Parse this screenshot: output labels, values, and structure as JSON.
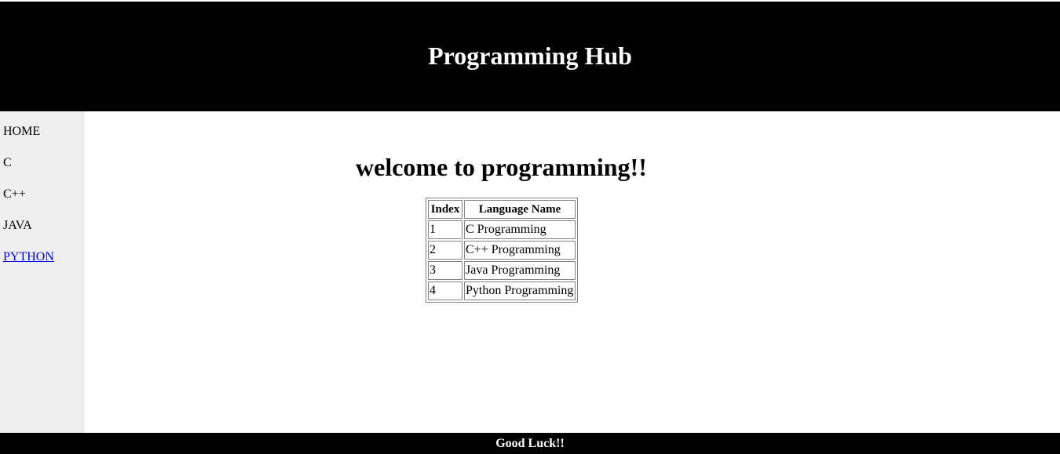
{
  "header": {
    "title": "Programming Hub"
  },
  "sidebar": {
    "items": [
      {
        "label": "HOME"
      },
      {
        "label": "C"
      },
      {
        "label": "C++"
      },
      {
        "label": "JAVA"
      },
      {
        "label": "PYTHON"
      }
    ],
    "active_item": "PYTHON"
  },
  "main": {
    "heading": "welcome to programming!!",
    "table": {
      "headers": [
        "Index",
        "Language Name"
      ],
      "rows": [
        [
          "1",
          "C Programming"
        ],
        [
          "2",
          "C++ Programming"
        ],
        [
          "3",
          "Java Programming"
        ],
        [
          "4",
          "Python Programming"
        ]
      ]
    }
  },
  "footer": {
    "text": "Good Luck!!"
  },
  "colors": {
    "header_bg": "#000000",
    "sidebar_bg": "#efefef",
    "link_active": "#0000ee",
    "footer_bg": "#000000"
  }
}
